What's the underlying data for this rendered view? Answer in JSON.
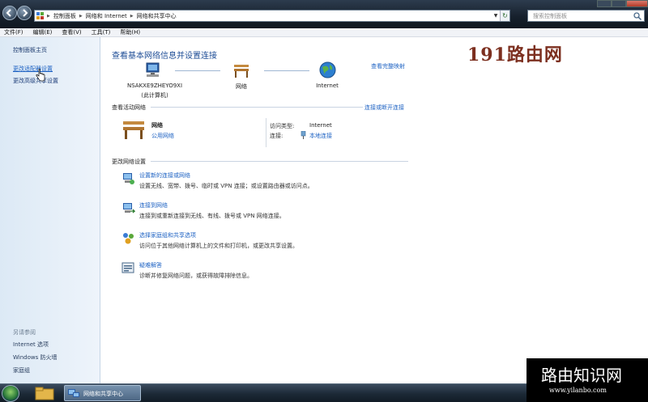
{
  "addressbar": {
    "breadcrumbs": [
      "控制面板",
      "网络和 Internet",
      "网络和共享中心"
    ],
    "search_placeholder": "搜索控制面板"
  },
  "menubar": {
    "items": [
      "文件(F)",
      "编辑(E)",
      "查看(V)",
      "工具(T)",
      "帮助(H)"
    ]
  },
  "leftpane": {
    "home": "控制面板主页",
    "links": [
      "更改适配器设置",
      "更改高级共享设置"
    ],
    "see_also": "另请参阅",
    "see_also_items": [
      "Internet 选项",
      "Windows 防火墙",
      "家庭组"
    ]
  },
  "main": {
    "title": "查看基本网络信息并设置连接",
    "see_full_map": "查看完整映射",
    "map_nodes": {
      "computer": "NSAKXE9ZHEYO9XI",
      "computer_sub": "(此计算机)",
      "network": "网络",
      "internet": "Internet"
    },
    "active_networks_title": "查看活动网络",
    "connect_disconnect": "连接或断开连接",
    "active_network": {
      "name": "网络",
      "type": "公用网络",
      "access_type_label": "访问类型:",
      "access_type_value": "Internet",
      "connections_label": "连接:",
      "connections_value": "本地连接"
    },
    "change_settings_title": "更改网络设置",
    "tasks": [
      {
        "title": "设置新的连接或网络",
        "desc": "设置无线、宽带、拨号、临时或 VPN 连接；或设置路由器或访问点。"
      },
      {
        "title": "连接到网络",
        "desc": "连接到或重新连接到无线、有线、拨号或 VPN 网络连接。"
      },
      {
        "title": "选择家庭组和共享选项",
        "desc": "访问位于其他网络计算机上的文件和打印机，或更改共享设置。"
      },
      {
        "title": "疑难解答",
        "desc": "诊断并修复网络问题，或获得故障排除信息。"
      }
    ]
  },
  "watermarks": {
    "top": "191路由网",
    "box_title": "路由知识网",
    "box_url": "www.yilanbo.com"
  },
  "taskbar": {
    "active_task": "网络和共享中心"
  },
  "colors": {
    "link": "#1d62c3",
    "title": "#1e4d96",
    "leftpane": "#dce9f5"
  }
}
